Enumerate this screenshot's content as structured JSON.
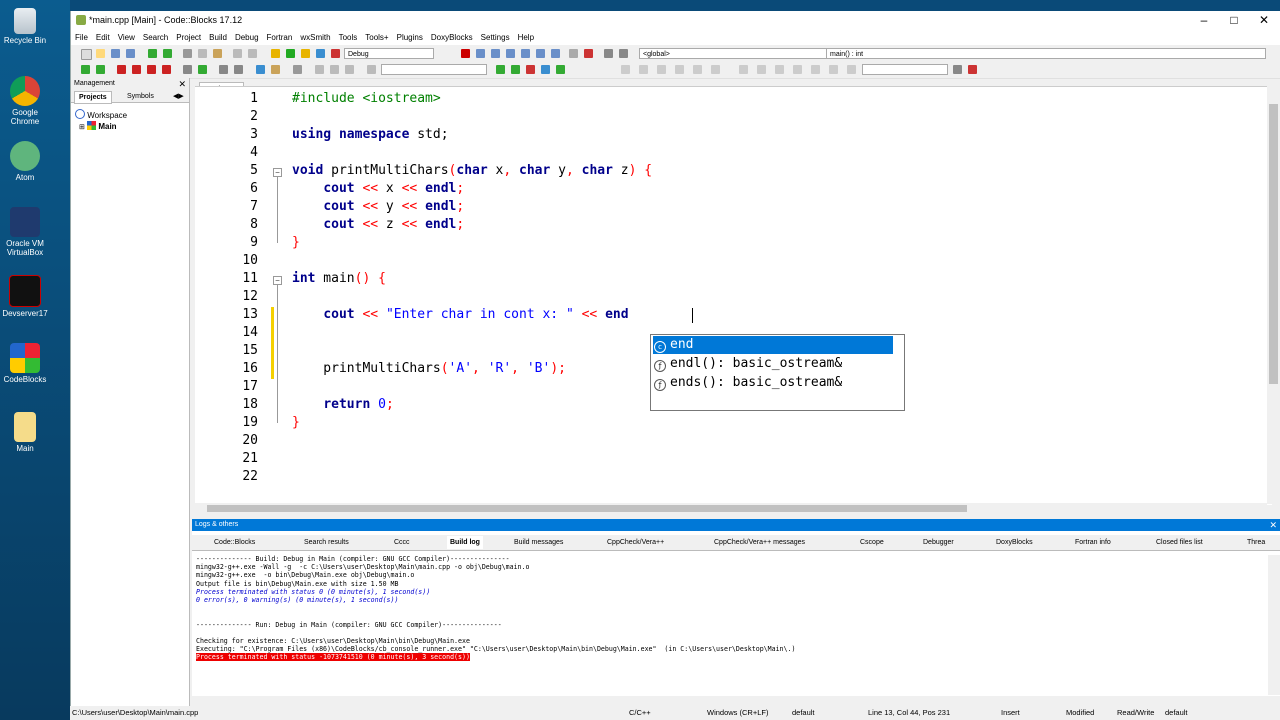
{
  "desktop": {
    "icons": [
      {
        "label": "Recycle Bin",
        "icon": "recycle-bin-icon"
      },
      {
        "label": "Google Chrome",
        "icon": "chrome-icon"
      },
      {
        "label": "Atom",
        "icon": "atom-icon"
      },
      {
        "label": "Oracle VM VirtualBox",
        "icon": "virtualbox-icon"
      },
      {
        "label": "Devserver17",
        "icon": "devserver-icon"
      },
      {
        "label": "CodeBlocks",
        "icon": "codeblocks-icon"
      },
      {
        "label": "Main",
        "icon": "folder-icon"
      }
    ]
  },
  "window": {
    "title": "*main.cpp [Main] - Code::Blocks 17.12",
    "menu": [
      "File",
      "Edit",
      "View",
      "Search",
      "Project",
      "Build",
      "Debug",
      "Fortran",
      "wxSmith",
      "Tools",
      "Tools+",
      "Plugins",
      "DoxyBlocks",
      "Settings",
      "Help"
    ],
    "build_target": "Debug",
    "scope": "<global>",
    "symbol": "main() : int"
  },
  "management": {
    "title": "Management",
    "tabs": [
      "Projects",
      "Symbols"
    ],
    "tree": [
      "Workspace",
      "Main"
    ]
  },
  "editor": {
    "tab": "*main.cpp",
    "line_numbers": [
      "1",
      "2",
      "3",
      "4",
      "5",
      "6",
      "7",
      "8",
      "9",
      "10",
      "11",
      "12",
      "13",
      "14",
      "15",
      "16",
      "17",
      "18",
      "19",
      "20",
      "21",
      "22"
    ],
    "lines": [
      {
        "parts": [
          {
            "c": "pp",
            "t": "#include <iostream>"
          }
        ]
      },
      {
        "parts": []
      },
      {
        "parts": [
          {
            "c": "kw",
            "t": "using namespace"
          },
          {
            "c": "",
            "t": " std;"
          }
        ]
      },
      {
        "parts": []
      },
      {
        "parts": [
          {
            "c": "kw",
            "t": "void"
          },
          {
            "c": "",
            "t": " printMultiChars"
          },
          {
            "c": "op",
            "t": "("
          },
          {
            "c": "kw",
            "t": "char"
          },
          {
            "c": "",
            "t": " x"
          },
          {
            "c": "op",
            "t": ","
          },
          {
            "c": "",
            "t": " "
          },
          {
            "c": "kw",
            "t": "char"
          },
          {
            "c": "",
            "t": " y"
          },
          {
            "c": "op",
            "t": ","
          },
          {
            "c": "",
            "t": " "
          },
          {
            "c": "kw",
            "t": "char"
          },
          {
            "c": "",
            "t": " z"
          },
          {
            "c": "op",
            "t": ")"
          },
          {
            "c": "",
            "t": " "
          },
          {
            "c": "op",
            "t": "{"
          }
        ]
      },
      {
        "parts": [
          {
            "c": "",
            "t": "    "
          },
          {
            "c": "kw",
            "t": "cout"
          },
          {
            "c": "",
            "t": " "
          },
          {
            "c": "op",
            "t": "<<"
          },
          {
            "c": "",
            "t": " x "
          },
          {
            "c": "op",
            "t": "<<"
          },
          {
            "c": "",
            "t": " "
          },
          {
            "c": "kw",
            "t": "endl"
          },
          {
            "c": "op",
            "t": ";"
          }
        ]
      },
      {
        "parts": [
          {
            "c": "",
            "t": "    "
          },
          {
            "c": "kw",
            "t": "cout"
          },
          {
            "c": "",
            "t": " "
          },
          {
            "c": "op",
            "t": "<<"
          },
          {
            "c": "",
            "t": " y "
          },
          {
            "c": "op",
            "t": "<<"
          },
          {
            "c": "",
            "t": " "
          },
          {
            "c": "kw",
            "t": "endl"
          },
          {
            "c": "op",
            "t": ";"
          }
        ]
      },
      {
        "parts": [
          {
            "c": "",
            "t": "    "
          },
          {
            "c": "kw",
            "t": "cout"
          },
          {
            "c": "",
            "t": " "
          },
          {
            "c": "op",
            "t": "<<"
          },
          {
            "c": "",
            "t": " z "
          },
          {
            "c": "op",
            "t": "<<"
          },
          {
            "c": "",
            "t": " "
          },
          {
            "c": "kw",
            "t": "endl"
          },
          {
            "c": "op",
            "t": ";"
          }
        ]
      },
      {
        "parts": [
          {
            "c": "op",
            "t": "}"
          }
        ]
      },
      {
        "parts": []
      },
      {
        "parts": [
          {
            "c": "kw",
            "t": "int"
          },
          {
            "c": "",
            "t": " main"
          },
          {
            "c": "op",
            "t": "()"
          },
          {
            "c": "",
            "t": " "
          },
          {
            "c": "op",
            "t": "{"
          }
        ]
      },
      {
        "parts": []
      },
      {
        "parts": [
          {
            "c": "",
            "t": "    "
          },
          {
            "c": "kw",
            "t": "cout"
          },
          {
            "c": "",
            "t": " "
          },
          {
            "c": "op",
            "t": "<<"
          },
          {
            "c": "",
            "t": " "
          },
          {
            "c": "st",
            "t": "\"Enter char in cont x: \""
          },
          {
            "c": "",
            "t": " "
          },
          {
            "c": "op",
            "t": "<<"
          },
          {
            "c": "",
            "t": " "
          },
          {
            "c": "kw",
            "t": "end"
          }
        ]
      },
      {
        "parts": []
      },
      {
        "parts": []
      },
      {
        "parts": [
          {
            "c": "",
            "t": "    printMultiChars"
          },
          {
            "c": "op",
            "t": "("
          },
          {
            "c": "ch",
            "t": "'A'"
          },
          {
            "c": "op",
            "t": ","
          },
          {
            "c": "",
            "t": " "
          },
          {
            "c": "ch",
            "t": "'R'"
          },
          {
            "c": "op",
            "t": ","
          },
          {
            "c": "",
            "t": " "
          },
          {
            "c": "ch",
            "t": "'B'"
          },
          {
            "c": "op",
            "t": ");"
          }
        ]
      },
      {
        "parts": []
      },
      {
        "parts": [
          {
            "c": "",
            "t": "    "
          },
          {
            "c": "kw",
            "t": "return"
          },
          {
            "c": "",
            "t": " "
          },
          {
            "c": "ch",
            "t": "0"
          },
          {
            "c": "op",
            "t": ";"
          }
        ]
      },
      {
        "parts": [
          {
            "c": "op",
            "t": "}"
          }
        ]
      },
      {
        "parts": []
      },
      {
        "parts": []
      },
      {
        "parts": []
      }
    ],
    "autocomplete": [
      "end",
      "endl(): basic_ostream&",
      "ends(): basic_ostream&"
    ]
  },
  "logs": {
    "title": "Logs & others",
    "tabs": [
      "Code::Blocks",
      "Search results",
      "Cccc",
      "Build log",
      "Build messages",
      "CppCheck/Vera++",
      "CppCheck/Vera++ messages",
      "Cscope",
      "Debugger",
      "DoxyBlocks",
      "Fortran info",
      "Closed files list",
      "Threa"
    ],
    "lines": [
      {
        "c": "",
        "t": "-------------- Build: Debug in Main (compiler: GNU GCC Compiler)---------------"
      },
      {
        "c": "",
        "t": "mingw32-g++.exe -Wall -g  -c C:\\Users\\user\\Desktop\\Main\\main.cpp -o obj\\Debug\\main.o"
      },
      {
        "c": "",
        "t": "mingw32-g++.exe  -o bin\\Debug\\Main.exe obj\\Debug\\main.o"
      },
      {
        "c": "",
        "t": "Output file is bin\\Debug\\Main.exe with size 1.50 MB"
      },
      {
        "c": "it",
        "t": "Process terminated with status 0 (0 minute(s), 1 second(s))"
      },
      {
        "c": "it",
        "t": "0 error(s), 0 warning(s) (0 minute(s), 1 second(s))"
      },
      {
        "c": "",
        "t": " "
      },
      {
        "c": "",
        "t": " "
      },
      {
        "c": "",
        "t": "-------------- Run: Debug in Main (compiler: GNU GCC Compiler)---------------"
      },
      {
        "c": "",
        "t": " "
      },
      {
        "c": "",
        "t": "Checking for existence: C:\\Users\\user\\Desktop\\Main\\bin\\Debug\\Main.exe"
      },
      {
        "c": "",
        "t": "Executing: \"C:\\Program Files (x86)\\CodeBlocks/cb_console_runner.exe\" \"C:\\Users\\user\\Desktop\\Main\\bin\\Debug\\Main.exe\"  (in C:\\Users\\user\\Desktop\\Main\\.)"
      },
      {
        "c": "err",
        "t": "Process terminated with status -1073741510 (0 minute(s), 3 second(s))"
      }
    ]
  },
  "status": {
    "path": "C:\\Users\\user\\Desktop\\Main\\main.cpp",
    "lang": "C/C++",
    "eol": "Windows (CR+LF)",
    "encoding": "default",
    "position": "Line 13, Col 44, Pos 231",
    "mode": "Insert",
    "modified": "Modified",
    "rw": "Read/Write",
    "profile": "default"
  }
}
